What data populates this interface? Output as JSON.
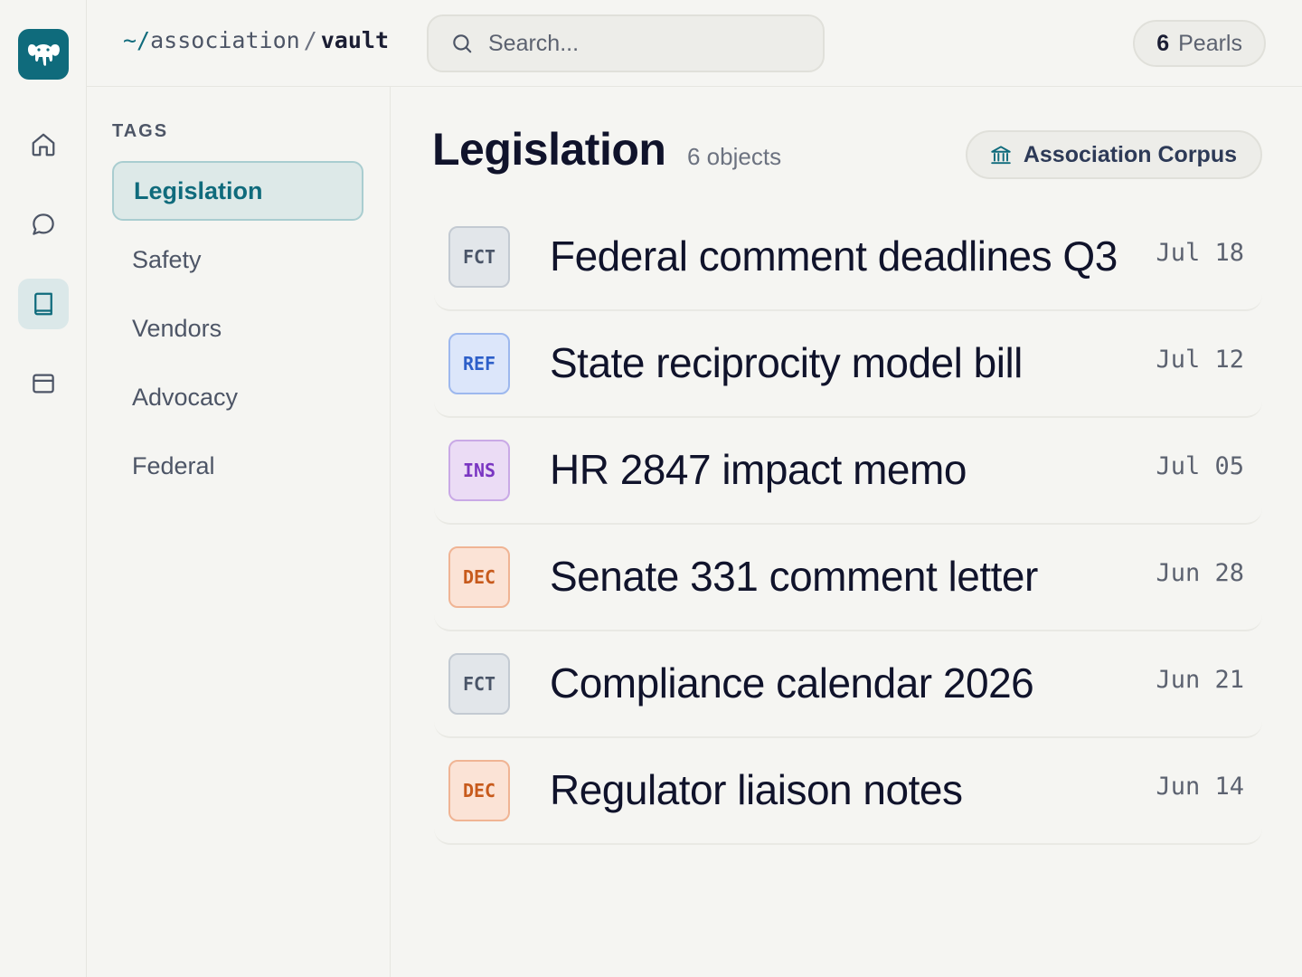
{
  "breadcrumb": {
    "root": "~/",
    "parent": "association",
    "separator": "/",
    "current": "vault"
  },
  "search": {
    "placeholder": "Search..."
  },
  "pearls": {
    "count": "6",
    "label": "Pearls"
  },
  "rail": {
    "logo_icon": "elephant-icon",
    "items": [
      {
        "icon": "home-icon",
        "active": false
      },
      {
        "icon": "chat-icon",
        "active": false
      },
      {
        "icon": "book-icon",
        "active": true
      },
      {
        "icon": "archive-icon",
        "active": false
      }
    ]
  },
  "tags": {
    "heading": "TAGS",
    "items": [
      "Legislation",
      "Safety",
      "Vendors",
      "Advocacy",
      "Federal"
    ],
    "active": "Legislation"
  },
  "main": {
    "title": "Legislation",
    "count": "6 objects",
    "corpus_button": {
      "label": "Association Corpus",
      "icon": "bank-icon"
    }
  },
  "badge_styles": {
    "FCT": {
      "bg": "#e2e6ea",
      "border": "#c3cad2",
      "fg": "#4a5568"
    },
    "REF": {
      "bg": "#dce6fa",
      "border": "#9db8ee",
      "fg": "#2d5fc9"
    },
    "INS": {
      "bg": "#ebdcf5",
      "border": "#c9a9e6",
      "fg": "#7a36c2"
    },
    "DEC": {
      "bg": "#fbe3d6",
      "border": "#f0b494",
      "fg": "#c75a1c"
    }
  },
  "objects": [
    {
      "badge": "FCT",
      "title": "Federal comment deadlines Q3",
      "date": "Jul 18"
    },
    {
      "badge": "REF",
      "title": "State reciprocity model bill",
      "date": "Jul 12"
    },
    {
      "badge": "INS",
      "title": "HR 2847 impact memo",
      "date": "Jul 05"
    },
    {
      "badge": "DEC",
      "title": "Senate 331 comment letter",
      "date": "Jun 28"
    },
    {
      "badge": "FCT",
      "title": "Compliance calendar 2026",
      "date": "Jun 21"
    },
    {
      "badge": "DEC",
      "title": "Regulator liaison notes",
      "date": "Jun 14"
    }
  ]
}
